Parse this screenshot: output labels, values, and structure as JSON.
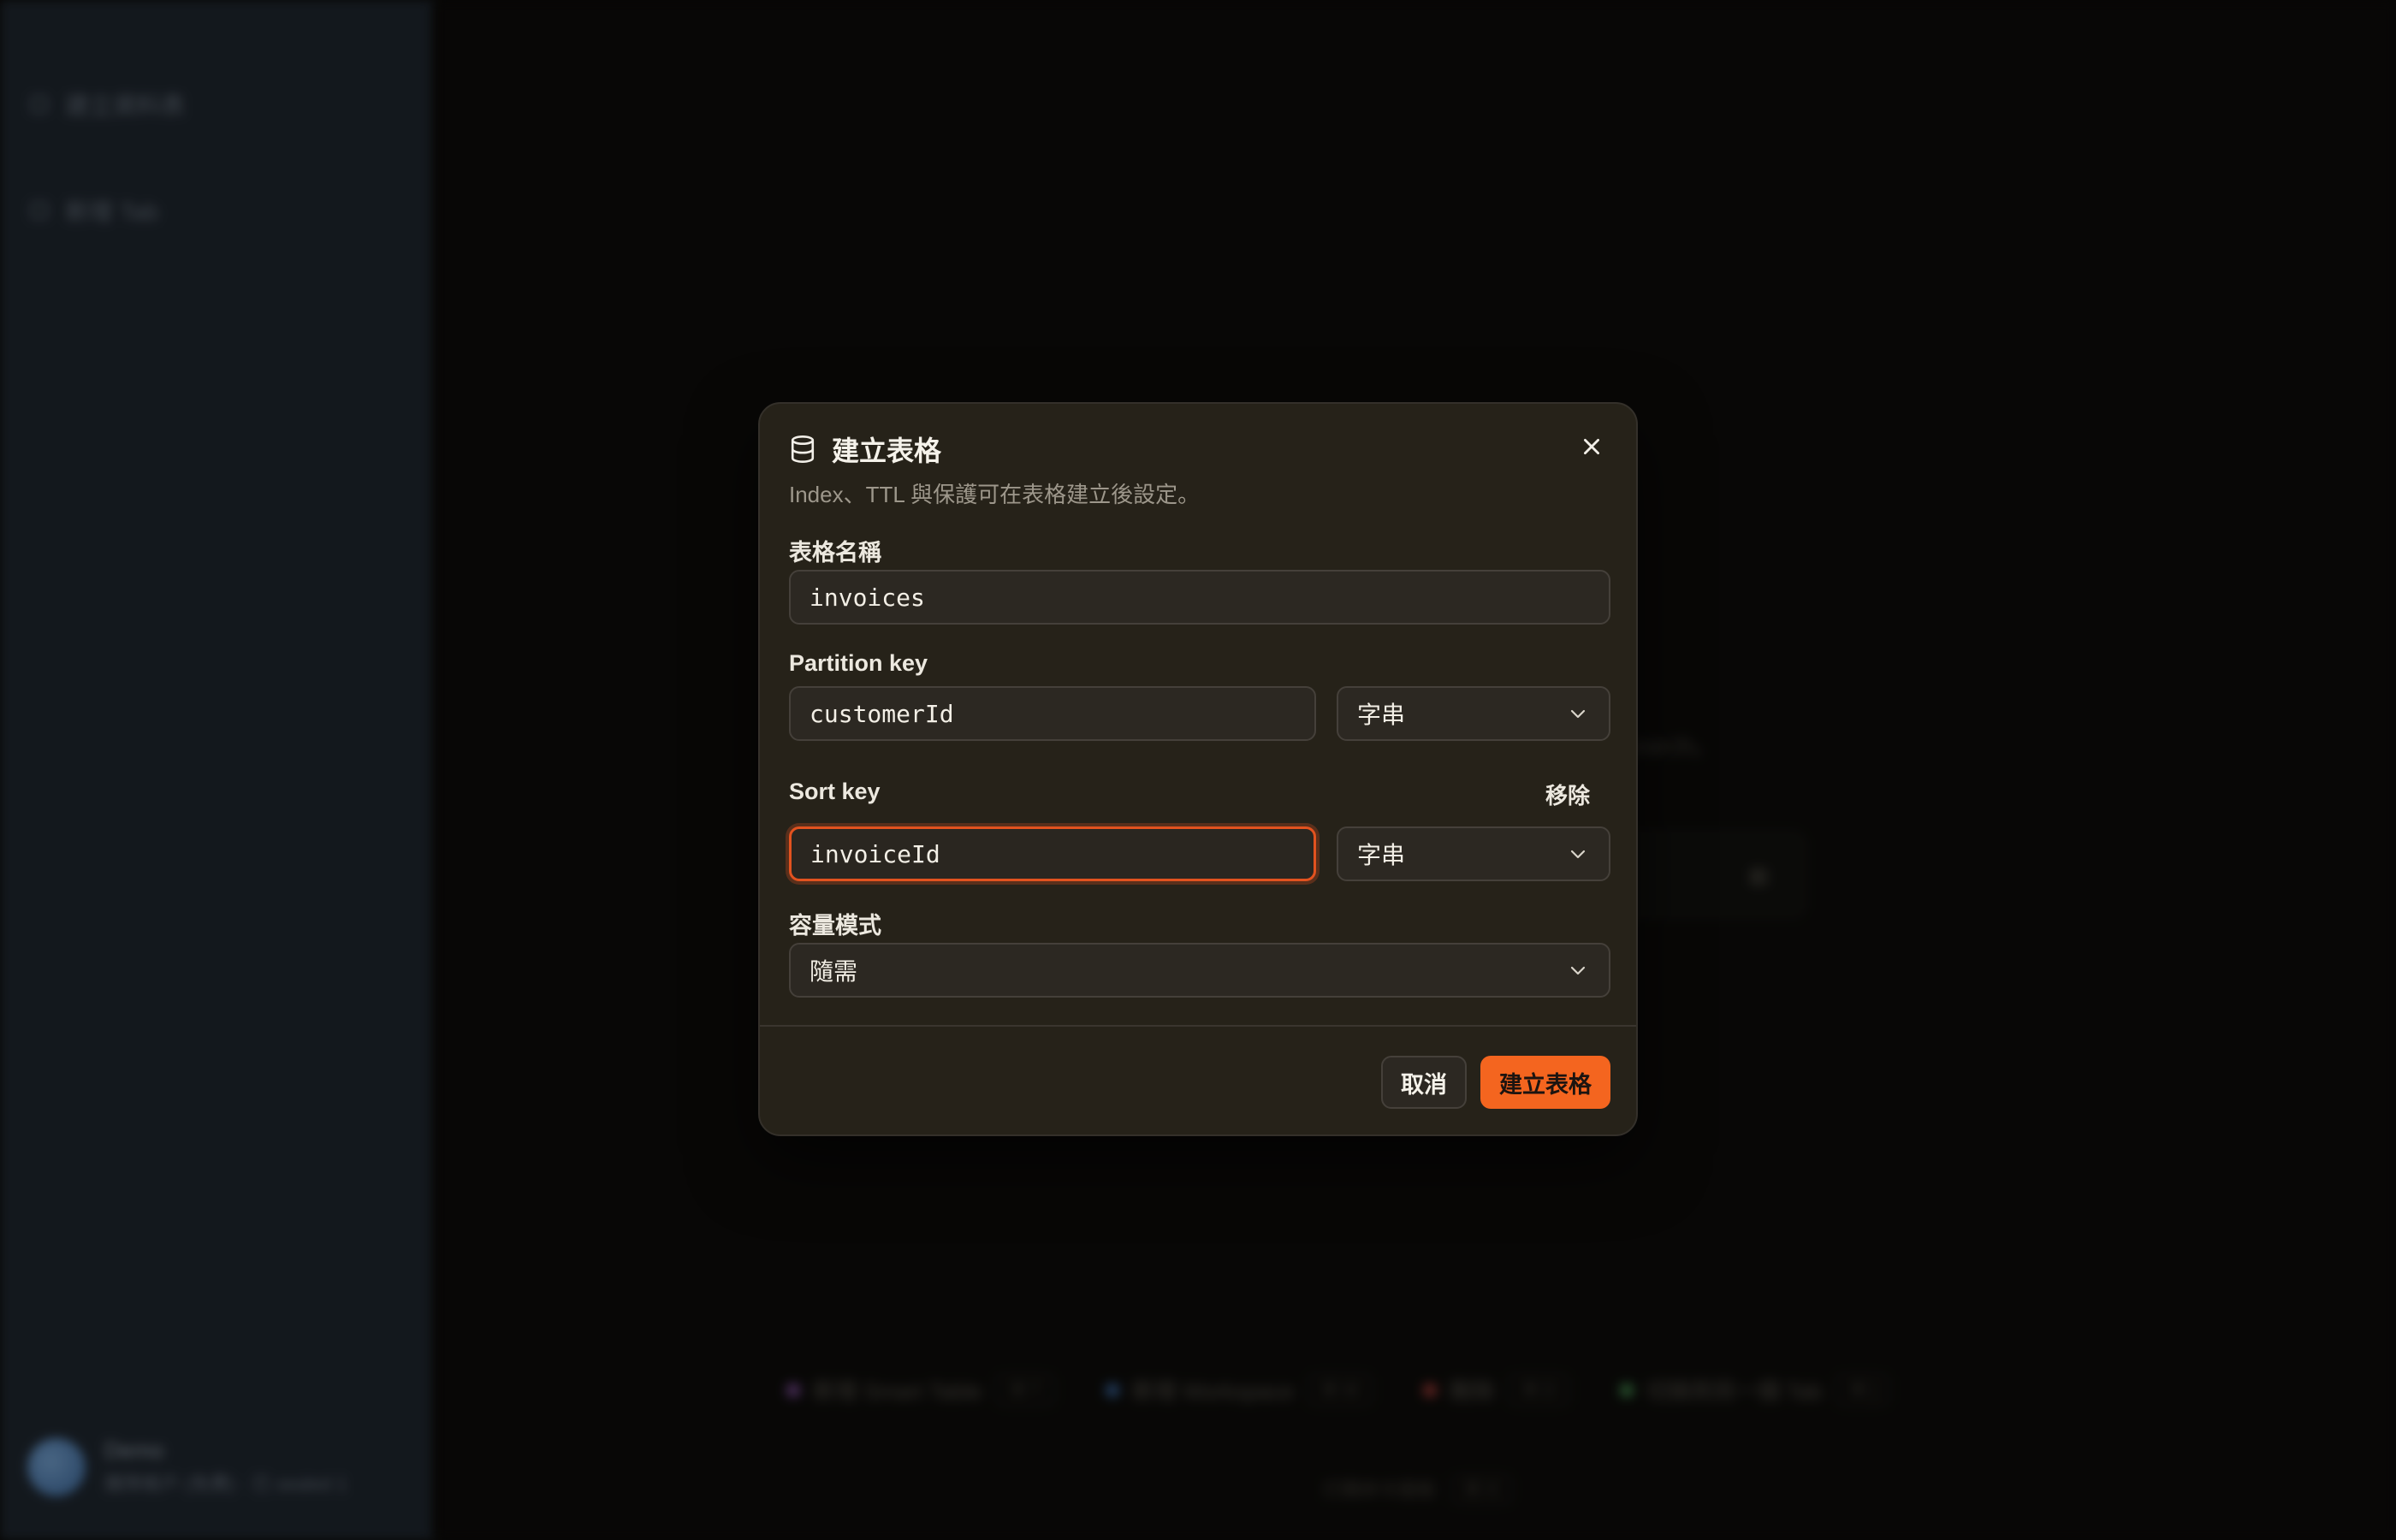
{
  "background": {
    "sidebar": {
      "items": [
        {
          "label": "建立資料表"
        },
        {
          "label": "新增 Tab"
        }
      ],
      "user": {
        "name": "Demo",
        "subtitle": "團隊帳戶 (免費) · 已 sealed 1"
      }
    },
    "note": "…earch。",
    "card_label": "新",
    "chips": [
      {
        "label": "新增 Smart Table",
        "tag": "⌘ T",
        "color": "#b06ad8"
      },
      {
        "label": "新增 Workspace",
        "tag": "⌘ W",
        "color": "#4f8fe0"
      },
      {
        "label": "刪除",
        "tag": "⌘ D",
        "color": "#e0504a"
      },
      {
        "label": "切換到另一個 Tab",
        "tag": "⌘ ]",
        "color": "#5cc06a"
      }
    ],
    "footer": {
      "label": "打開命令面板",
      "tag": "⌘ K"
    }
  },
  "modal": {
    "title": "建立表格",
    "subtitle": "Index、TTL 與保護可在表格建立後設定。",
    "table_name": {
      "label": "表格名稱",
      "value": "invoices"
    },
    "partition_key": {
      "label": "Partition key",
      "value": "customerId",
      "type": "字串"
    },
    "sort_key": {
      "label": "Sort key",
      "value": "invoiceId",
      "type": "字串",
      "remove_label": "移除"
    },
    "capacity_mode": {
      "label": "容量模式",
      "value": "隨需"
    },
    "cancel_label": "取消",
    "create_label": "建立表格"
  },
  "colors": {
    "accent": "#f4651f",
    "focus_ring": "#e2521f",
    "modal_bg": "#262219",
    "sidebar_bg": "#222a33"
  },
  "icons": {
    "title_icon": "database-icon",
    "close": "close-icon",
    "select": "chevron-down-icon"
  }
}
